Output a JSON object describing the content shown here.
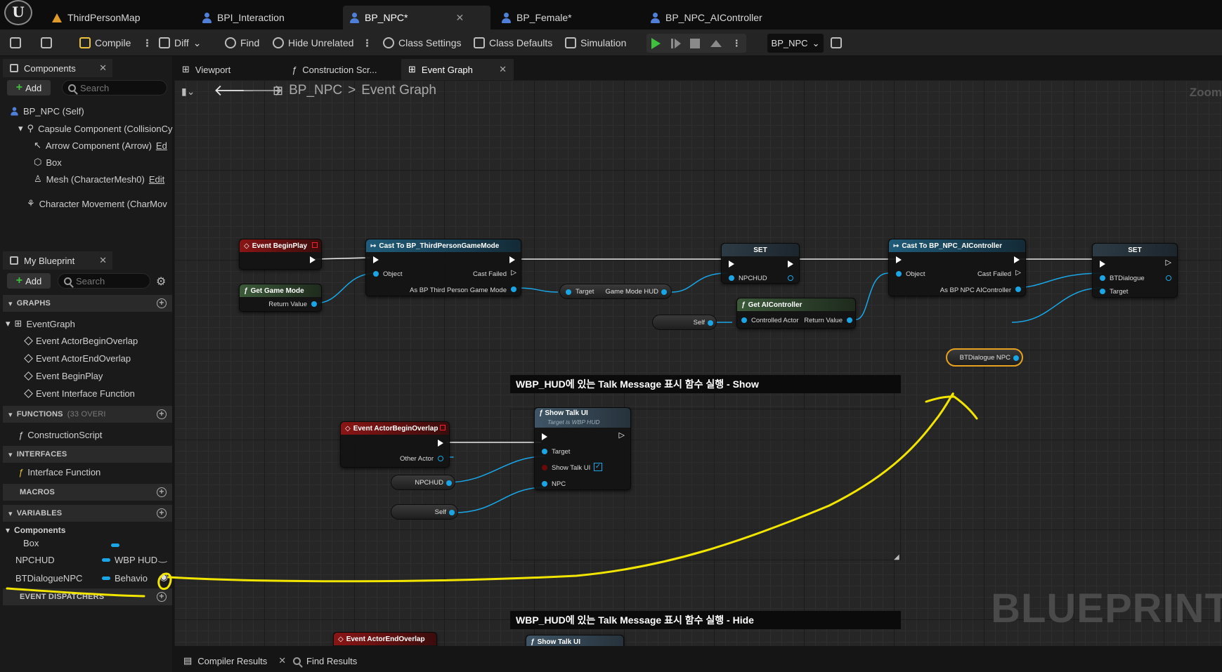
{
  "doc_tabs": [
    {
      "label": "ThirdPersonMap",
      "icon": "map-icon"
    },
    {
      "label": "BPI_Interaction",
      "icon": "interface-icon"
    },
    {
      "label": "BP_NPC*",
      "icon": "blueprint-person-icon",
      "active": true
    },
    {
      "label": "BP_Female*",
      "icon": "blueprint-person-icon"
    },
    {
      "label": "BP_NPC_AIController",
      "icon": "controller-icon"
    }
  ],
  "toolbar": {
    "compile": "Compile",
    "diff": "Diff",
    "find": "Find",
    "hide_unrelated": "Hide Unrelated",
    "class_settings": "Class Settings",
    "class_defaults": "Class Defaults",
    "simulation": "Simulation",
    "debug_object": "BP_NPC"
  },
  "components_panel": {
    "title": "Components",
    "add": "Add",
    "search_placeholder": "Search",
    "items": [
      {
        "label": "BP_NPC (Self)"
      },
      {
        "label": "Capsule Component (CollisionCy"
      },
      {
        "label": "Arrow Component (Arrow)",
        "edit": "Ed"
      },
      {
        "label": "Box"
      },
      {
        "label": "Mesh (CharacterMesh0)",
        "edit": "Edit"
      },
      {
        "label": "Character Movement (CharMov"
      }
    ]
  },
  "my_blueprint": {
    "title": "My Blueprint",
    "add": "Add",
    "search_placeholder": "Search",
    "graphs_header": "GRAPHS",
    "graphs": [
      "EventGraph",
      "Event ActorBeginOverlap",
      "Event ActorEndOverlap",
      "Event BeginPlay",
      "Event Interface Function"
    ],
    "functions_header": "FUNCTIONS",
    "functions_note": "(33 OVERI",
    "functions": [
      "ConstructionScript"
    ],
    "interfaces_header": "INTERFACES",
    "interfaces": [
      "Interface Function"
    ],
    "macros_header": "MACROS",
    "variables_header": "VARIABLES",
    "variables_group": "Components",
    "variables": [
      {
        "name": "Box",
        "type": ""
      },
      {
        "name": "NPCHUD",
        "type": "WBP HUD"
      },
      {
        "name": "BTDialogueNPC",
        "type": "Behavio"
      }
    ],
    "dispatchers_header": "EVENT DISPATCHERS"
  },
  "graph_tabs": [
    "Viewport",
    "Construction Scr...",
    "Event Graph"
  ],
  "breadcrumb": {
    "root": "BP_NPC",
    "sep": ">",
    "current": "Event Graph"
  },
  "zoom_label": "Zoom",
  "watermark": "BLUEPRINT",
  "nodes": {
    "begin_play": "Event BeginPlay",
    "get_game_mode": "Get Game Mode",
    "return_value": "Return Value",
    "cast_gamemode": "Cast To BP_ThirdPersonGameMode",
    "object": "Object",
    "cast_failed": "Cast Failed",
    "as_gamemode": "As BP Third Person Game Mode",
    "target": "Target",
    "game_mode_hud": "Game Mode HUD",
    "set": "SET",
    "npchud": "NPCHUD",
    "self": "Self",
    "get_ai_controller": "Get AIController",
    "controlled_actor": "Controlled Actor",
    "cast_ai": "Cast To BP_NPC_AIController",
    "as_ai": "As BP NPC AIController",
    "bt_dialogue": "BTDialogue",
    "bt_dialogue_npc": "BTDialogue NPC",
    "actor_begin_overlap": "Event ActorBeginOverlap",
    "other_actor": "Other Actor",
    "show_talk_ui": "Show Talk UI",
    "target_is": "Target is WBP HUD",
    "show_talk_ui_pin": "Show Talk UI",
    "npc": "NPC",
    "actor_end_overlap": "Event ActorEndOverlap"
  },
  "comments": {
    "show": "WBP_HUD에 있는 Talk Message 표시 함수 실행 - Show",
    "hide": "WBP_HUD에 있는 Talk Message 표시 함수 실행 - Hide"
  },
  "bottom_tabs": [
    "Compiler Results",
    "Find Results"
  ],
  "colors": {
    "accent_exec": "#ffffff",
    "object_pin": "#1aa6e6",
    "annotation": "#f2e600"
  }
}
